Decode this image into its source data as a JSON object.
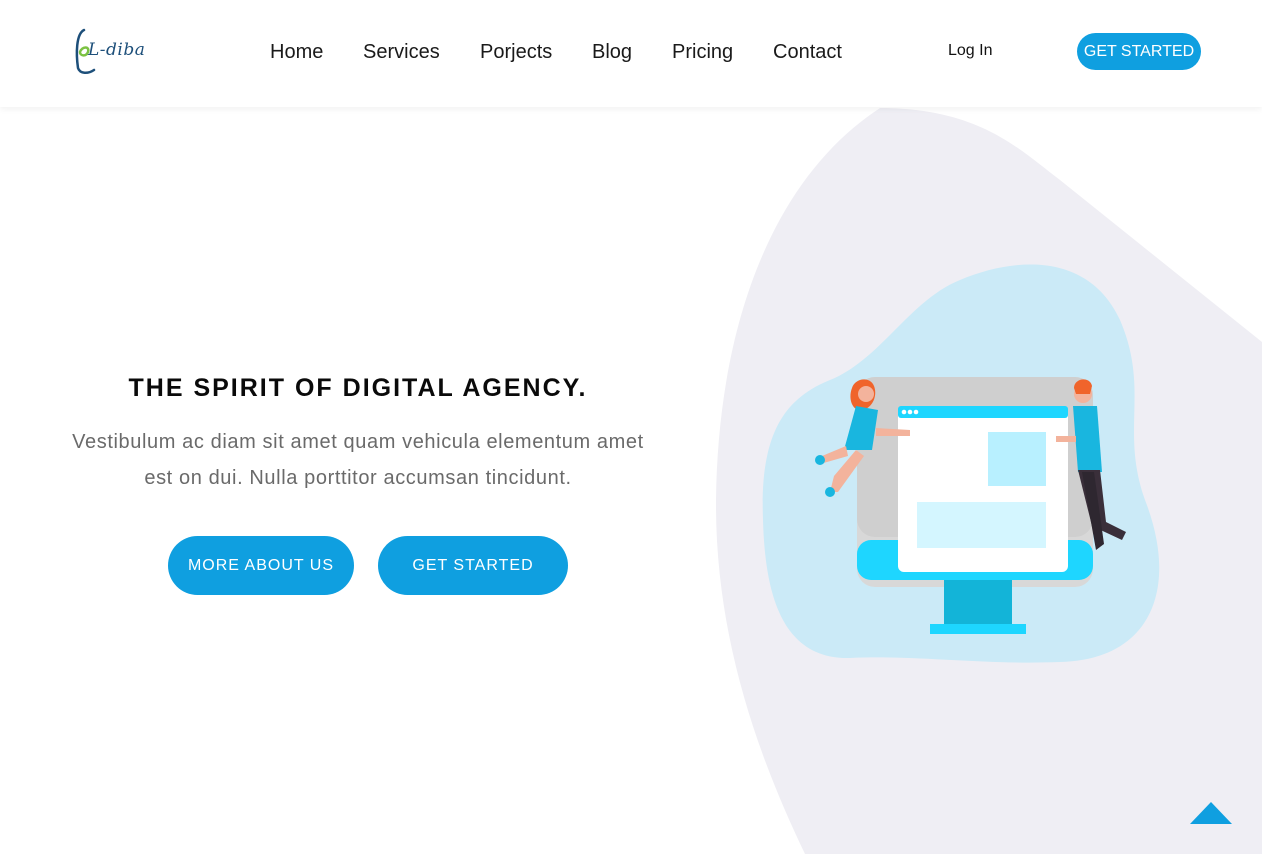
{
  "brand": {
    "logo_text": "L-diba",
    "accent_color": "#0f9fe0"
  },
  "nav": {
    "items": [
      "Home",
      "Services",
      "Porjects",
      "Blog",
      "Pricing",
      "Contact"
    ],
    "login_label": "Log In",
    "cta_label": "GET STARTED"
  },
  "hero": {
    "title": "THE SPIRIT OF DIGITAL AGENCY.",
    "text_line1": "Vestibulum ac diam sit amet quam vehicula elementum amet",
    "text_line2": "est on dui. Nulla porttitor accumsan tincidunt.",
    "button_more": "MORE ABOUT US",
    "button_start": "GET STARTED"
  },
  "icons": {
    "scroll_top": "chevron-up-icon"
  }
}
